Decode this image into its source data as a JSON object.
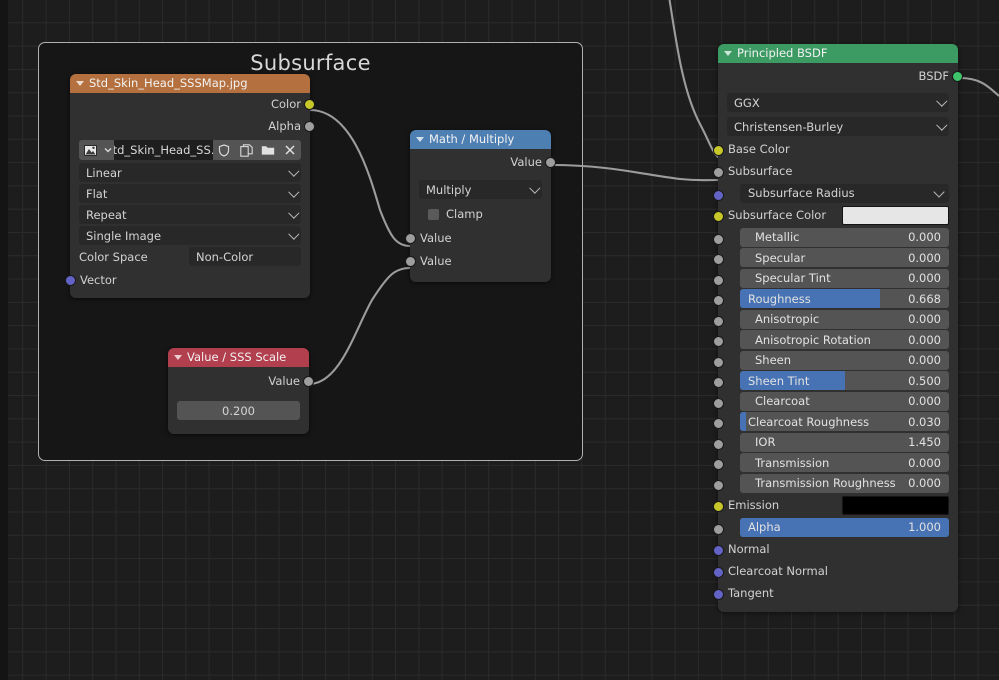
{
  "editor": {
    "background_color": "#1d1d1d",
    "grid_color": "#2b2b2b"
  },
  "frame": {
    "label": "Subsurface",
    "border_color": "#b0b0b0"
  },
  "nodes": {
    "image_texture": {
      "title": "Std_Skin_Head_SSSMap.jpg",
      "header_color": "#b4713f",
      "outputs": [
        {
          "label": "Color",
          "socket": "yellow"
        },
        {
          "label": "Alpha",
          "socket": "grey"
        }
      ],
      "image_picker": {
        "browse_icon": "image-browse-icon",
        "chevron_icon": "chevron-down-icon",
        "name": "Std_Skin_Head_SS...",
        "fake_user_icon": "shield-icon",
        "new_icon": "copy-icon",
        "open_icon": "folder-icon",
        "unlink_icon": "close-icon"
      },
      "dropdowns": [
        {
          "name": "interpolation",
          "value": "Linear"
        },
        {
          "name": "projection",
          "value": "Flat"
        },
        {
          "name": "extension",
          "value": "Repeat"
        },
        {
          "name": "source",
          "value": "Single Image"
        }
      ],
      "color_space": {
        "label": "Color Space",
        "value": "Non-Color"
      },
      "inputs": [
        {
          "label": "Vector",
          "socket": "purple"
        }
      ]
    },
    "math": {
      "title": "Math / Multiply",
      "header_color": "#4d7fb3",
      "outputs": [
        {
          "label": "Value",
          "socket": "grey"
        }
      ],
      "operation": "Multiply",
      "clamp": {
        "label": "Clamp",
        "checked": false
      },
      "inputs": [
        {
          "label": "Value",
          "socket": "grey"
        },
        {
          "label": "Value",
          "socket": "grey"
        }
      ]
    },
    "value": {
      "title": "Value / SSS Scale",
      "header_color": "#b23f4d",
      "outputs": [
        {
          "label": "Value",
          "socket": "grey"
        }
      ],
      "value": "0.200"
    },
    "principled": {
      "title": "Principled BSDF",
      "header_color": "#3c9a63",
      "outputs": [
        {
          "label": "BSDF",
          "socket": "green"
        }
      ],
      "distribution": "GGX",
      "subsurface_method": "Christensen-Burley",
      "fields": [
        {
          "name": "base-color",
          "label": "Base Color",
          "socket": "yellow",
          "kind": "socket-label"
        },
        {
          "name": "subsurface",
          "label": "Subsurface",
          "socket": "grey",
          "kind": "socket-label"
        },
        {
          "name": "subsurface-radius",
          "label": "Subsurface Radius",
          "socket": "purple",
          "kind": "dropdown"
        },
        {
          "name": "subsurface-color",
          "label": "Subsurface Color",
          "socket": "yellow",
          "kind": "swatch",
          "color": "#e6e6e6"
        },
        {
          "name": "metallic",
          "label": "Metallic",
          "socket": "grey",
          "kind": "slider",
          "value": "0.000",
          "fill": 0
        },
        {
          "name": "specular",
          "label": "Specular",
          "socket": "grey",
          "kind": "slider",
          "value": "0.000",
          "fill": 0
        },
        {
          "name": "specular-tint",
          "label": "Specular Tint",
          "socket": "grey",
          "kind": "slider",
          "value": "0.000",
          "fill": 0
        },
        {
          "name": "roughness",
          "label": "Roughness",
          "socket": "grey",
          "kind": "slider",
          "value": "0.668",
          "fill": 66.8
        },
        {
          "name": "anisotropic",
          "label": "Anisotropic",
          "socket": "grey",
          "kind": "slider",
          "value": "0.000",
          "fill": 0
        },
        {
          "name": "anisotropic-rotation",
          "label": "Anisotropic Rotation",
          "socket": "grey",
          "kind": "slider",
          "value": "0.000",
          "fill": 0
        },
        {
          "name": "sheen",
          "label": "Sheen",
          "socket": "grey",
          "kind": "slider",
          "value": "0.000",
          "fill": 0
        },
        {
          "name": "sheen-tint",
          "label": "Sheen Tint",
          "socket": "grey",
          "kind": "slider",
          "value": "0.500",
          "fill": 50
        },
        {
          "name": "clearcoat",
          "label": "Clearcoat",
          "socket": "grey",
          "kind": "slider",
          "value": "0.000",
          "fill": 0
        },
        {
          "name": "clearcoat-roughness",
          "label": "Clearcoat Roughness",
          "socket": "grey",
          "kind": "slider",
          "value": "0.030",
          "fill": 3
        },
        {
          "name": "ior",
          "label": "IOR",
          "socket": "grey",
          "kind": "slider",
          "value": "1.450",
          "fill": 0
        },
        {
          "name": "transmission",
          "label": "Transmission",
          "socket": "grey",
          "kind": "slider",
          "value": "0.000",
          "fill": 0
        },
        {
          "name": "transmission-roughness",
          "label": "Transmission Roughness",
          "socket": "grey",
          "kind": "slider",
          "value": "0.000",
          "fill": 0
        },
        {
          "name": "emission",
          "label": "Emission",
          "socket": "yellow",
          "kind": "swatch",
          "color": "#000000"
        },
        {
          "name": "alpha",
          "label": "Alpha",
          "socket": "grey",
          "kind": "slider",
          "value": "1.000",
          "fill": 100
        },
        {
          "name": "normal",
          "label": "Normal",
          "socket": "purple",
          "kind": "socket-label"
        },
        {
          "name": "clearcoat-normal",
          "label": "Clearcoat Normal",
          "socket": "purple",
          "kind": "socket-label"
        },
        {
          "name": "tangent",
          "label": "Tangent",
          "socket": "purple",
          "kind": "socket-label"
        }
      ]
    }
  }
}
